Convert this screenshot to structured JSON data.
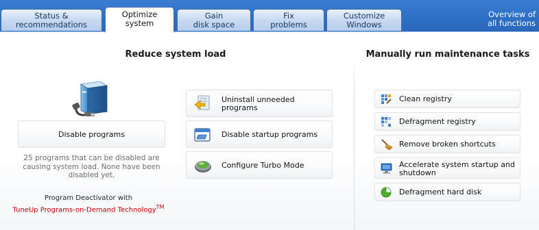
{
  "tabs": [
    {
      "line1": "Status &",
      "line2": "recommendations"
    },
    {
      "line1": "Optimize",
      "line2": "system"
    },
    {
      "line1": "Gain",
      "line2": "disk space"
    },
    {
      "line1": "Fix",
      "line2": "problems"
    },
    {
      "line1": "Customize",
      "line2": "Windows"
    }
  ],
  "active_tab": "Optimize system",
  "overview": {
    "line1": "Overview of",
    "line2": "all functions"
  },
  "left": {
    "title": "Reduce system load",
    "disable_programs_label": "Disable programs",
    "status_note": "25 programs that can be disabled are causing system load. None have been disabled yet.",
    "deactivator_line1": "Program Deactivator with",
    "deactivator_line2": "TuneUp Programs-on-Demand Technology",
    "trademark": "TM"
  },
  "middle": {
    "buttons": [
      {
        "label": "Uninstall unneeded programs",
        "icon": "uninstall-icon"
      },
      {
        "label": "Disable startup programs",
        "icon": "startup-window-icon"
      },
      {
        "label": "Configure Turbo Mode",
        "icon": "turbo-mode-icon"
      }
    ]
  },
  "right": {
    "title": "Manually run maintenance tasks",
    "tasks": [
      {
        "label": "Clean registry",
        "icon": "registry-clean-icon"
      },
      {
        "label": "Defragment registry",
        "icon": "registry-defrag-icon"
      },
      {
        "label": "Remove broken shortcuts",
        "icon": "broom-icon"
      },
      {
        "label": "Accelerate system startup and shutdown",
        "icon": "monitor-icon"
      },
      {
        "label": "Defragment hard disk",
        "icon": "disk-defrag-icon"
      }
    ]
  }
}
